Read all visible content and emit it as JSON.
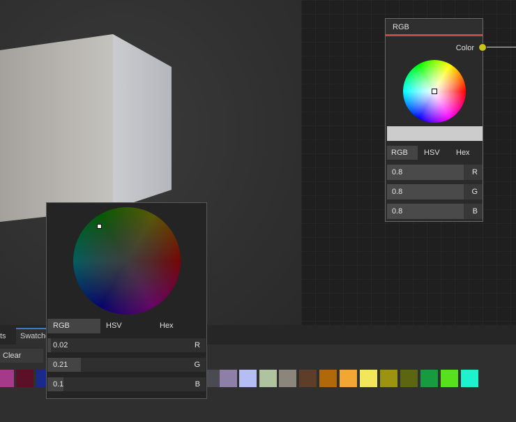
{
  "node": {
    "title": "RGB",
    "output_label": "Color",
    "tabs": [
      "RGB",
      "HSV",
      "Hex"
    ],
    "fields": [
      {
        "value": "0.8",
        "channel": "R",
        "fill": 0.8
      },
      {
        "value": "0.8",
        "channel": "G",
        "fill": 0.8
      },
      {
        "value": "0.8",
        "channel": "B",
        "fill": 0.8
      }
    ],
    "preview_color": "#cccccc",
    "header_accent": "#c74848",
    "socket_color": "#c8c41a"
  },
  "popup": {
    "tabs": [
      "RGB",
      "HSV",
      "Hex"
    ],
    "fields": [
      {
        "value": "0.02",
        "channel": "R",
        "fill": 0.02
      },
      {
        "value": "0.21",
        "channel": "G",
        "fill": 0.21
      },
      {
        "value": "0.1",
        "channel": "B",
        "fill": 0.1
      }
    ]
  },
  "bottom": {
    "tab_assets": "ts",
    "tab_swatches": "Swatche",
    "clear_label": "Clear",
    "swatches": [
      "#a63a8a",
      "#5c1028",
      "#1a2a8a",
      "#4a4a52",
      "#8e7fa8",
      "#b6bcf4",
      "#aec39e",
      "#8c857c",
      "#5e3e28",
      "#b0690a",
      "#f2a634",
      "#f2e65a",
      "#9c9410",
      "#5c6612",
      "#189a40",
      "#58e01c",
      "#1cf2cc"
    ]
  }
}
